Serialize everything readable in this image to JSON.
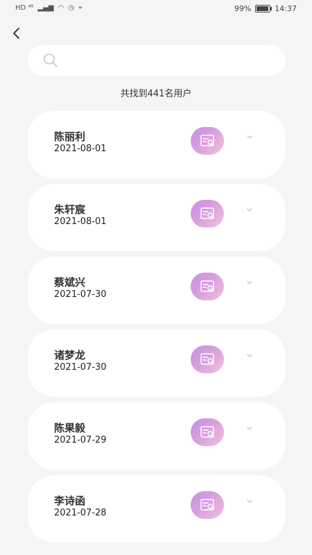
{
  "status_bar": {
    "left_indicators": "HD ⁴⁶",
    "battery": "99%",
    "time": "14:37"
  },
  "search": {
    "value": "",
    "placeholder": ""
  },
  "result_count": "共找到441名用户",
  "users": [
    {
      "name": "陈丽利",
      "date": "2021-08-01"
    },
    {
      "name": "朱轩宸",
      "date": "2021-08-01"
    },
    {
      "name": "蔡斌兴",
      "date": "2021-07-30"
    },
    {
      "name": "诸梦龙",
      "date": "2021-07-30"
    },
    {
      "name": "陈果毅",
      "date": "2021-07-29"
    },
    {
      "name": "李诗函",
      "date": "2021-07-28"
    }
  ],
  "colors": {
    "background": "#f5f5f7",
    "card": "#ffffff",
    "action_gradient_start": "#c98de3",
    "action_gradient_end": "#f0c3d6"
  },
  "icons": {
    "back": "back-arrow-icon",
    "search": "search-icon",
    "action": "document-search-icon",
    "expand": "chevron-down-icon"
  }
}
